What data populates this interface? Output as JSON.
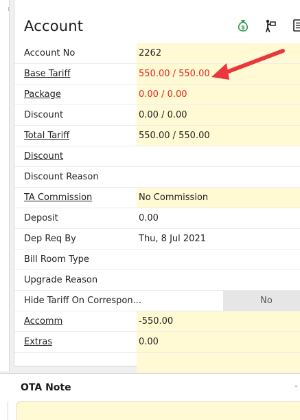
{
  "account": {
    "title": "Account",
    "icons": [
      "money-bag-icon",
      "person-sign-icon",
      "receipt-icon"
    ],
    "rows": [
      {
        "label": "Account No",
        "value": "2262"
      },
      {
        "label": "Base Tariff",
        "value": "550.00 / 550.00"
      },
      {
        "label": "Package",
        "value": "0.00 / 0.00"
      },
      {
        "label": "Discount",
        "value": "0.00 / 0.00"
      },
      {
        "label": "Total Tariff",
        "value": "550.00 / 550.00"
      },
      {
        "label": "Discount",
        "value": ""
      },
      {
        "label": "Discount Reason",
        "value": ""
      },
      {
        "label": "TA Commission",
        "value": "No Commission"
      },
      {
        "label": "Deposit",
        "value": "0.00"
      },
      {
        "label": "Dep Req By",
        "value": "Thu, 8 Jul 2021"
      },
      {
        "label": "Bill Room Type",
        "value": ""
      },
      {
        "label": "Upgrade Reason",
        "value": ""
      },
      {
        "label": "Hide Tariff On Correspon...",
        "value": "No"
      },
      {
        "label": "Accomm",
        "value": "-550.00"
      },
      {
        "label": "Extras",
        "value": "0.00"
      }
    ]
  },
  "ota": {
    "title": "OTA Note",
    "note_value": ""
  },
  "colors": {
    "field_yellow": "#fff9d4",
    "tariff_red": "#e3271e",
    "arrow_red": "#e8383d"
  }
}
